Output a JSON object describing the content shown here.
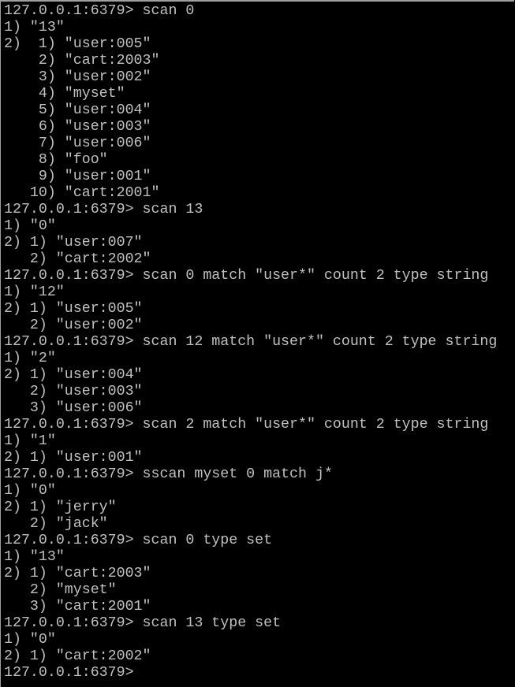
{
  "terminal": {
    "lines": [
      "127.0.0.1:6379> scan 0",
      "1) \"13\"",
      "2)  1) \"user:005\"",
      "    2) \"cart:2003\"",
      "    3) \"user:002\"",
      "    4) \"myset\"",
      "    5) \"user:004\"",
      "    6) \"user:003\"",
      "    7) \"user:006\"",
      "    8) \"foo\"",
      "    9) \"user:001\"",
      "   10) \"cart:2001\"",
      "127.0.0.1:6379> scan 13",
      "1) \"0\"",
      "2) 1) \"user:007\"",
      "   2) \"cart:2002\"",
      "127.0.0.1:6379> scan 0 match \"user*\" count 2 type string",
      "1) \"12\"",
      "2) 1) \"user:005\"",
      "   2) \"user:002\"",
      "127.0.0.1:6379> scan 12 match \"user*\" count 2 type string",
      "1) \"2\"",
      "2) 1) \"user:004\"",
      "   2) \"user:003\"",
      "   3) \"user:006\"",
      "127.0.0.1:6379> scan 2 match \"user*\" count 2 type string",
      "1) \"1\"",
      "2) 1) \"user:001\"",
      "127.0.0.1:6379> sscan myset 0 match j*",
      "1) \"0\"",
      "2) 1) \"jerry\"",
      "   2) \"jack\"",
      "127.0.0.1:6379> scan 0 type set",
      "1) \"13\"",
      "2) 1) \"cart:2003\"",
      "   2) \"myset\"",
      "   3) \"cart:2001\"",
      "127.0.0.1:6379> scan 13 type set",
      "1) \"0\"",
      "2) 1) \"cart:2002\"",
      "127.0.0.1:6379> "
    ],
    "colors": {
      "background": "#000000",
      "text": "#c0c0c0"
    }
  }
}
